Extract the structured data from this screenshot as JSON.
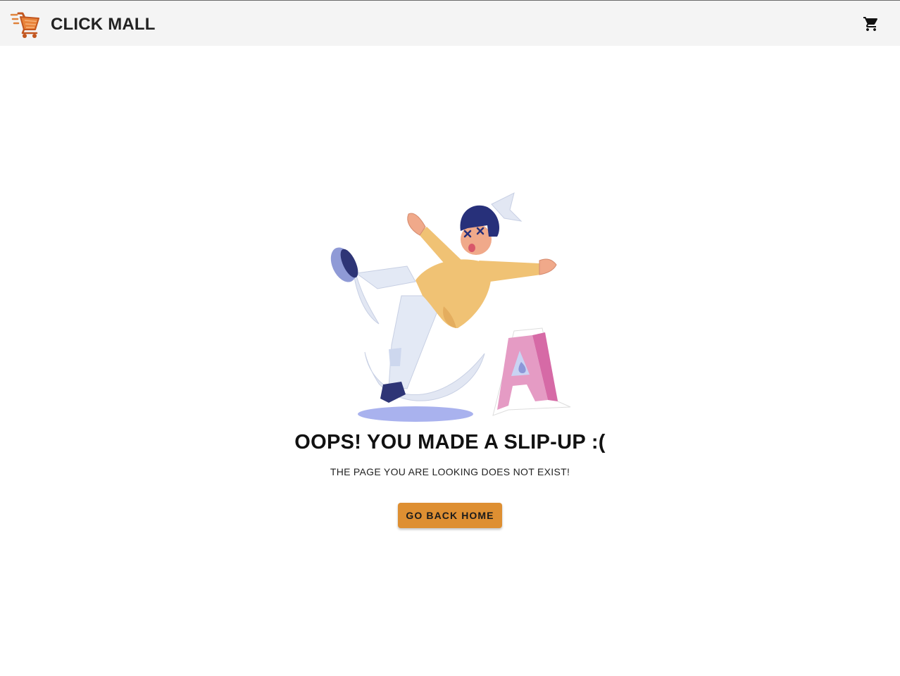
{
  "header": {
    "brand_title": "CLICK MALL",
    "logo_icon": "shopping-cart-logo-icon",
    "cart_icon": "shopping-cart-icon",
    "background_color": "#f4f4f4"
  },
  "error_page": {
    "illustration": "person-slipping-on-wet-floor-illustration",
    "heading": "OOPS! YOU MADE A SLIP-UP :(",
    "message": "THE PAGE YOU ARE LOOKING DOES NOT EXIST!",
    "home_button_label": "GO BACK HOME",
    "accent_color": "#de8f32"
  }
}
